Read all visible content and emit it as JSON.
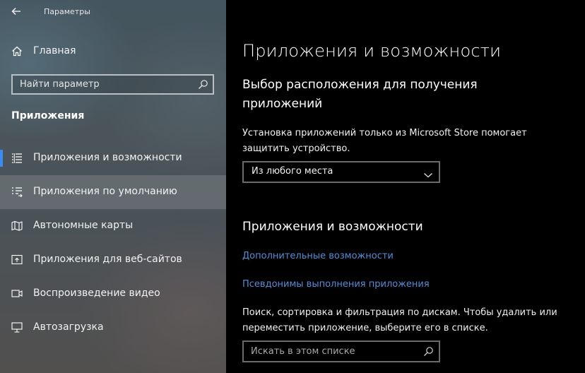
{
  "window": {
    "title": "Параметры"
  },
  "sidebar": {
    "home_label": "Главная",
    "search_placeholder": "Найти параметр",
    "section_heading": "Приложения",
    "items": [
      {
        "label": "Приложения и возможности",
        "icon": "apps-list-icon",
        "selected": true
      },
      {
        "label": "Приложения по умолчанию",
        "icon": "default-apps-icon",
        "hovered": true
      },
      {
        "label": "Автономные карты",
        "icon": "offline-maps-icon"
      },
      {
        "label": "Приложения для веб-сайтов",
        "icon": "apps-for-websites-icon"
      },
      {
        "label": "Воспроизведение видео",
        "icon": "video-playback-icon"
      },
      {
        "label": "Автозагрузка",
        "icon": "startup-icon"
      }
    ]
  },
  "main": {
    "page_title": "Приложения и возможности",
    "install_section": {
      "heading_line1": "Выбор расположения для получения",
      "heading_line2": "приложений",
      "description_line1": "Установка приложений только из Microsoft Store помогает",
      "description_line2": "защитить устройство.",
      "dropdown_value": "Из любого места"
    },
    "apps_section": {
      "heading": "Приложения и возможности",
      "link_optional_features": "Дополнительные возможности",
      "link_execution_aliases": "Псевдонимы выполнения приложения",
      "description_line1": "Поиск, сортировка и фильтрация по дискам. Чтобы удалить или",
      "description_line2": "переместить приложение, выберите его в списке.",
      "search_placeholder": "Искать в этом списке"
    }
  },
  "colors": {
    "accent": "#3a8cf0",
    "link": "#4f8fd9",
    "main_background": "#000000",
    "control_border": "#6a6a6a"
  }
}
